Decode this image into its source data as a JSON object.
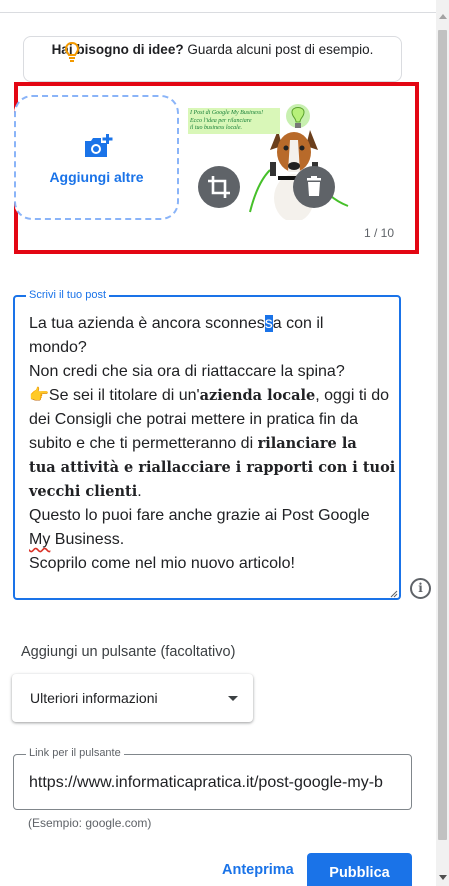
{
  "tip": {
    "bold": "Hai bisogno di idee?",
    "text": " Guarda alcuni post di esempio.",
    "icon": "lightbulb-icon"
  },
  "media": {
    "add_label": "Aggiungi altre",
    "add_icon": "add-photo-icon",
    "thumbnail_text": [
      "I Post di Google My Business!",
      "Ecco l'idea per rilanciare",
      "il tuo business locale."
    ],
    "counter": "1 / 10",
    "crop_icon": "crop-icon",
    "delete_icon": "trash-icon"
  },
  "post": {
    "label": "Scrivi il tuo post",
    "l1_a": "La tua azienda è ancora sconnes",
    "l1_sel": "s",
    "l1_b": "a con il",
    "l2": "mondo?",
    "l3": "Non credi che sia ora di riattaccare la spina?",
    "l4_a": "👉Se sei il titolare di un'",
    "l4_bold": "azienda locale",
    "l4_b": ", oggi ti do",
    "l5": "dei Consigli che potrai mettere in pratica fin da",
    "l6_a": "subito e che ti permetteranno di ",
    "l6_bold": "rilanciare la",
    "l7_bold": "tua attività e riallacciare i rapporti con i tuoi",
    "l8_bold": "vecchi clienti",
    "l8_b": ".",
    "l9": "Questo lo puoi fare anche grazie ai Post Google",
    "l10_sq": "My",
    "l10_b": " Business.",
    "l11": "Scoprilo come nel mio nuovo articolo!",
    "info_icon": "info-icon"
  },
  "cta": {
    "heading": "Aggiungi un pulsante (facoltativo)",
    "selected": "Ulteriori informazioni"
  },
  "link": {
    "label": "Link per il pulsante",
    "value": "https://www.informaticapratica.it/post-google-my-b",
    "hint": "(Esempio: google.com)"
  },
  "actions": {
    "preview": "Anteprima",
    "publish": "Pubblica"
  },
  "colors": {
    "accent": "#1a73e8",
    "highlight_frame": "#e30613"
  }
}
